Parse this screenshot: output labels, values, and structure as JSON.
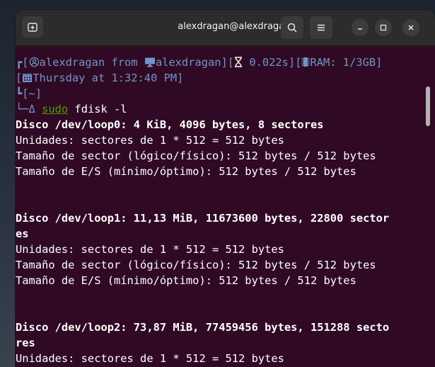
{
  "window": {
    "title": "alexdragan@alexdragan:~"
  },
  "colors": {
    "terminal_bg": "#300a24",
    "prompt": "#7393c9",
    "sudo": "#4e9a06",
    "titlebar": "#2c2c2c"
  },
  "icons": {
    "new_tab": "new-tab-icon",
    "search": "search-icon",
    "menu": "hamburger-menu-icon",
    "minimize": "minimize-icon",
    "maximize": "maximize-icon",
    "close": "close-icon",
    "user": "user-icon",
    "computer": "monitor-icon",
    "timer": "hourglass-icon",
    "ram": "chip-icon",
    "calendar": "calendar-icon"
  },
  "prompt": {
    "line1_pre": "┏[",
    "user": "alexdragan",
    "from": " from ",
    "host": "alexdragan",
    "mid": "][",
    "duration": " 0.022s",
    "mid2": "][",
    "ram": "RAM: 1/3GB",
    "end": "]",
    "line2_pre": "[",
    "datetime": "Thursday at 1:32:40 PM",
    "line2_end": "]",
    "line3": "┗[~]",
    "line4_pre": "└─Δ ",
    "cmd_sudo": "sudo",
    "cmd_rest": " fdisk -l"
  },
  "output": [
    {
      "text": "Disco /dev/loop0: 4 KiB, 4096 bytes, 8 sectores",
      "bold": true
    },
    {
      "text": "Unidades: sectores de 1 * 512 = 512 bytes",
      "bold": false
    },
    {
      "text": "Tamaño de sector (lógico/físico): 512 bytes / 512 bytes",
      "bold": false
    },
    {
      "text": "Tamaño de E/S (mínimo/óptimo): 512 bytes / 512 bytes",
      "bold": false
    },
    {
      "text": "",
      "bold": false
    },
    {
      "text": "",
      "bold": false
    },
    {
      "text": "Disco /dev/loop1: 11,13 MiB, 11673600 bytes, 22800 sector",
      "bold": true
    },
    {
      "text": "es",
      "bold": true
    },
    {
      "text": "Unidades: sectores de 1 * 512 = 512 bytes",
      "bold": false
    },
    {
      "text": "Tamaño de sector (lógico/físico): 512 bytes / 512 bytes",
      "bold": false
    },
    {
      "text": "Tamaño de E/S (mínimo/óptimo): 512 bytes / 512 bytes",
      "bold": false
    },
    {
      "text": "",
      "bold": false
    },
    {
      "text": "",
      "bold": false
    },
    {
      "text": "Disco /dev/loop2: 73,87 MiB, 77459456 bytes, 151288 secto",
      "bold": true
    },
    {
      "text": "res",
      "bold": true
    },
    {
      "text": "Unidades: sectores de 1 * 512 = 512 bytes",
      "bold": false
    }
  ]
}
